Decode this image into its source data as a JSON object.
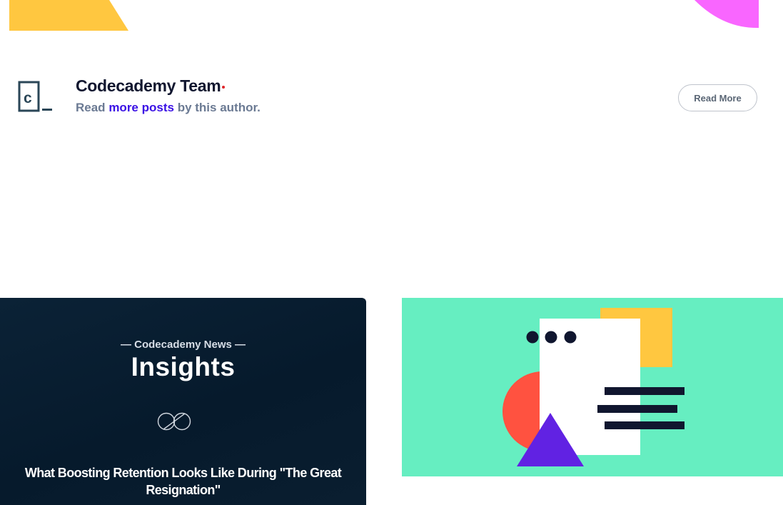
{
  "author": {
    "name": "Codecademy Team",
    "line_prefix": "Read",
    "line_link": "more posts",
    "line_suffix": "by this author.",
    "logo_icon": "codecademy-logo-icon",
    "read_more_label": "Read More"
  },
  "cards": {
    "insights": {
      "kicker": "— Codecademy News —",
      "title": "Insights",
      "icon": "infinity-icon",
      "article_title": "What Boosting Retention Looks Like During \"The Great Resignation\""
    }
  },
  "colors": {
    "hero_yellow": "#ffc740",
    "hero_pink": "#f966ff",
    "author_name": "#10162f",
    "author_muted": "#6b7a93",
    "link": "#3a10e5",
    "card_dark": "#061a2c",
    "illo_green": "#66eec1",
    "illo_yellow": "#ffc740",
    "illo_red": "#ff5240",
    "illo_purple": "#6122e3",
    "illo_navy": "#10162f"
  }
}
